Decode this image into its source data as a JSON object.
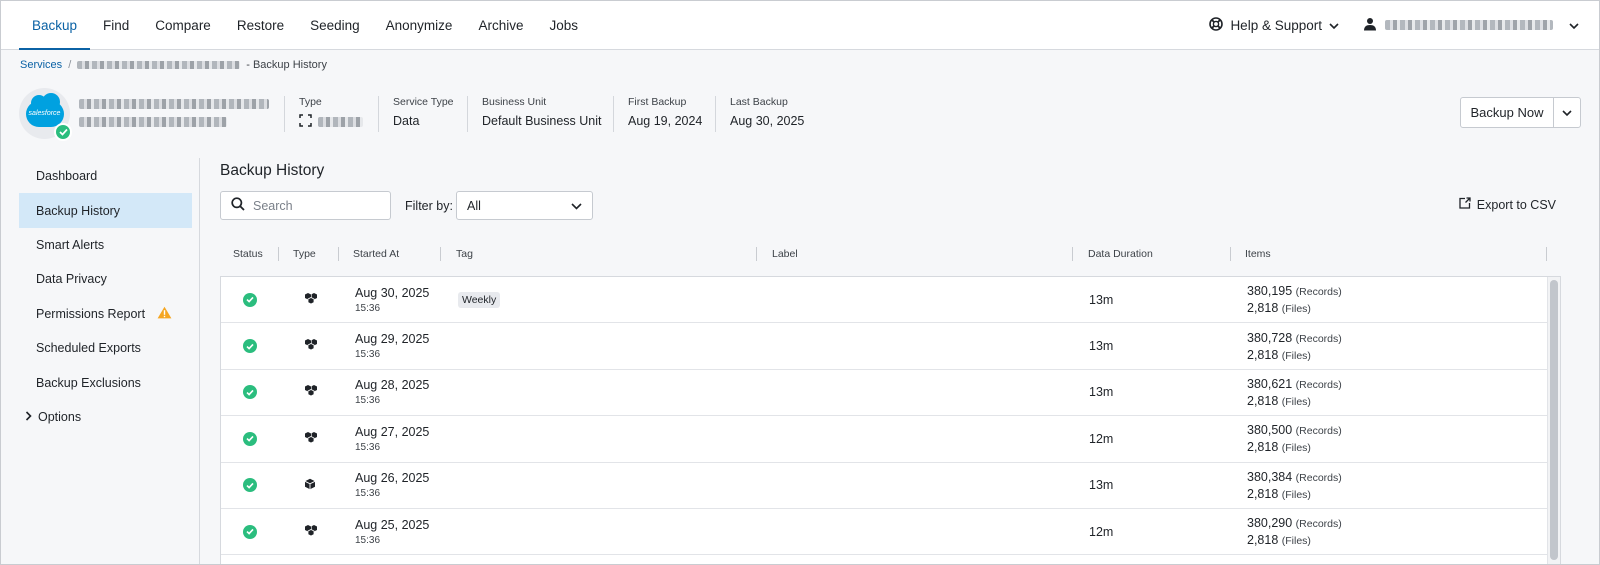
{
  "nav": {
    "tabs": [
      "Backup",
      "Find",
      "Compare",
      "Restore",
      "Seeding",
      "Anonymize",
      "Archive",
      "Jobs"
    ],
    "active_tab": "Backup",
    "help_label": "Help & Support"
  },
  "breadcrumb": {
    "services": "Services",
    "separator": "/",
    "current": "- Backup History"
  },
  "service": {
    "logo_text": "salesforce",
    "meta": [
      {
        "label": "Type",
        "value": ""
      },
      {
        "label": "Service Type",
        "value": "Data"
      },
      {
        "label": "Business Unit",
        "value": "Default Business Unit"
      },
      {
        "label": "First Backup",
        "value": "Aug 19, 2024"
      },
      {
        "label": "Last Backup",
        "value": "Aug 30, 2025"
      }
    ],
    "backup_now": "Backup Now"
  },
  "sidebar": {
    "items": [
      "Dashboard",
      "Backup History",
      "Smart Alerts",
      "Data Privacy",
      "Permissions Report",
      "Scheduled Exports",
      "Backup Exclusions"
    ],
    "active": "Backup History",
    "options": "Options"
  },
  "main": {
    "title": "Backup History",
    "search_placeholder": "Search",
    "filter_label": "Filter by:",
    "filter_value": "All",
    "export_label": "Export to CSV"
  },
  "table": {
    "columns": [
      "Status",
      "Type",
      "Started At",
      "Tag",
      "Label",
      "Data Duration",
      "Items"
    ],
    "records_unit": "(Records)",
    "files_unit": "(Files)",
    "rows": [
      {
        "date": "Aug 30, 2025",
        "time": "15:36",
        "tag": "Weekly",
        "label": "",
        "duration": "13m",
        "records": "380,195",
        "files": "2,818",
        "type_icon": "multi-cube-icon"
      },
      {
        "date": "Aug 29, 2025",
        "time": "15:36",
        "tag": "",
        "label": "",
        "duration": "13m",
        "records": "380,728",
        "files": "2,818",
        "type_icon": "multi-cube-icon"
      },
      {
        "date": "Aug 28, 2025",
        "time": "15:36",
        "tag": "",
        "label": "",
        "duration": "13m",
        "records": "380,621",
        "files": "2,818",
        "type_icon": "multi-cube-icon"
      },
      {
        "date": "Aug 27, 2025",
        "time": "15:36",
        "tag": "",
        "label": "",
        "duration": "12m",
        "records": "380,500",
        "files": "2,818",
        "type_icon": "multi-cube-icon"
      },
      {
        "date": "Aug 26, 2025",
        "time": "15:36",
        "tag": "",
        "label": "",
        "duration": "13m",
        "records": "380,384",
        "files": "2,818",
        "type_icon": "single-cube-icon"
      },
      {
        "date": "Aug 25, 2025",
        "time": "15:36",
        "tag": "",
        "label": "",
        "duration": "12m",
        "records": "380,290",
        "files": "2,818",
        "type_icon": "multi-cube-icon"
      }
    ]
  },
  "colors": {
    "accent": "#0b62a5",
    "success": "#2bbd7e",
    "sidebar_active": "#d3e8f8",
    "warning": "#f5a623"
  }
}
